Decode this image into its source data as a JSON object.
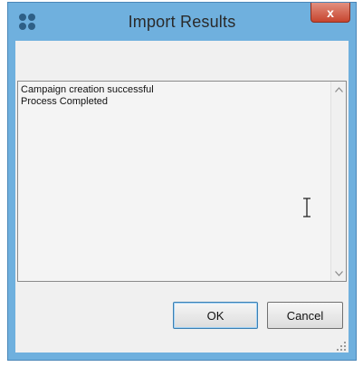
{
  "window": {
    "title": "Import Results",
    "close_label": "x"
  },
  "results": {
    "lines": [
      "Campaign creation successful",
      "Process Completed"
    ]
  },
  "buttons": {
    "ok_label": "OK",
    "cancel_label": "Cancel"
  },
  "colors": {
    "titlebar": "#6fb0de",
    "close_button": "#c7452f",
    "client_bg": "#f0f0f0"
  },
  "icons": {
    "app": "app-icon",
    "close": "close-icon",
    "scroll_up": "scroll-up-icon",
    "scroll_down": "scroll-down-icon",
    "text_cursor": "text-cursor-icon",
    "resize_grip": "resize-grip-icon"
  }
}
